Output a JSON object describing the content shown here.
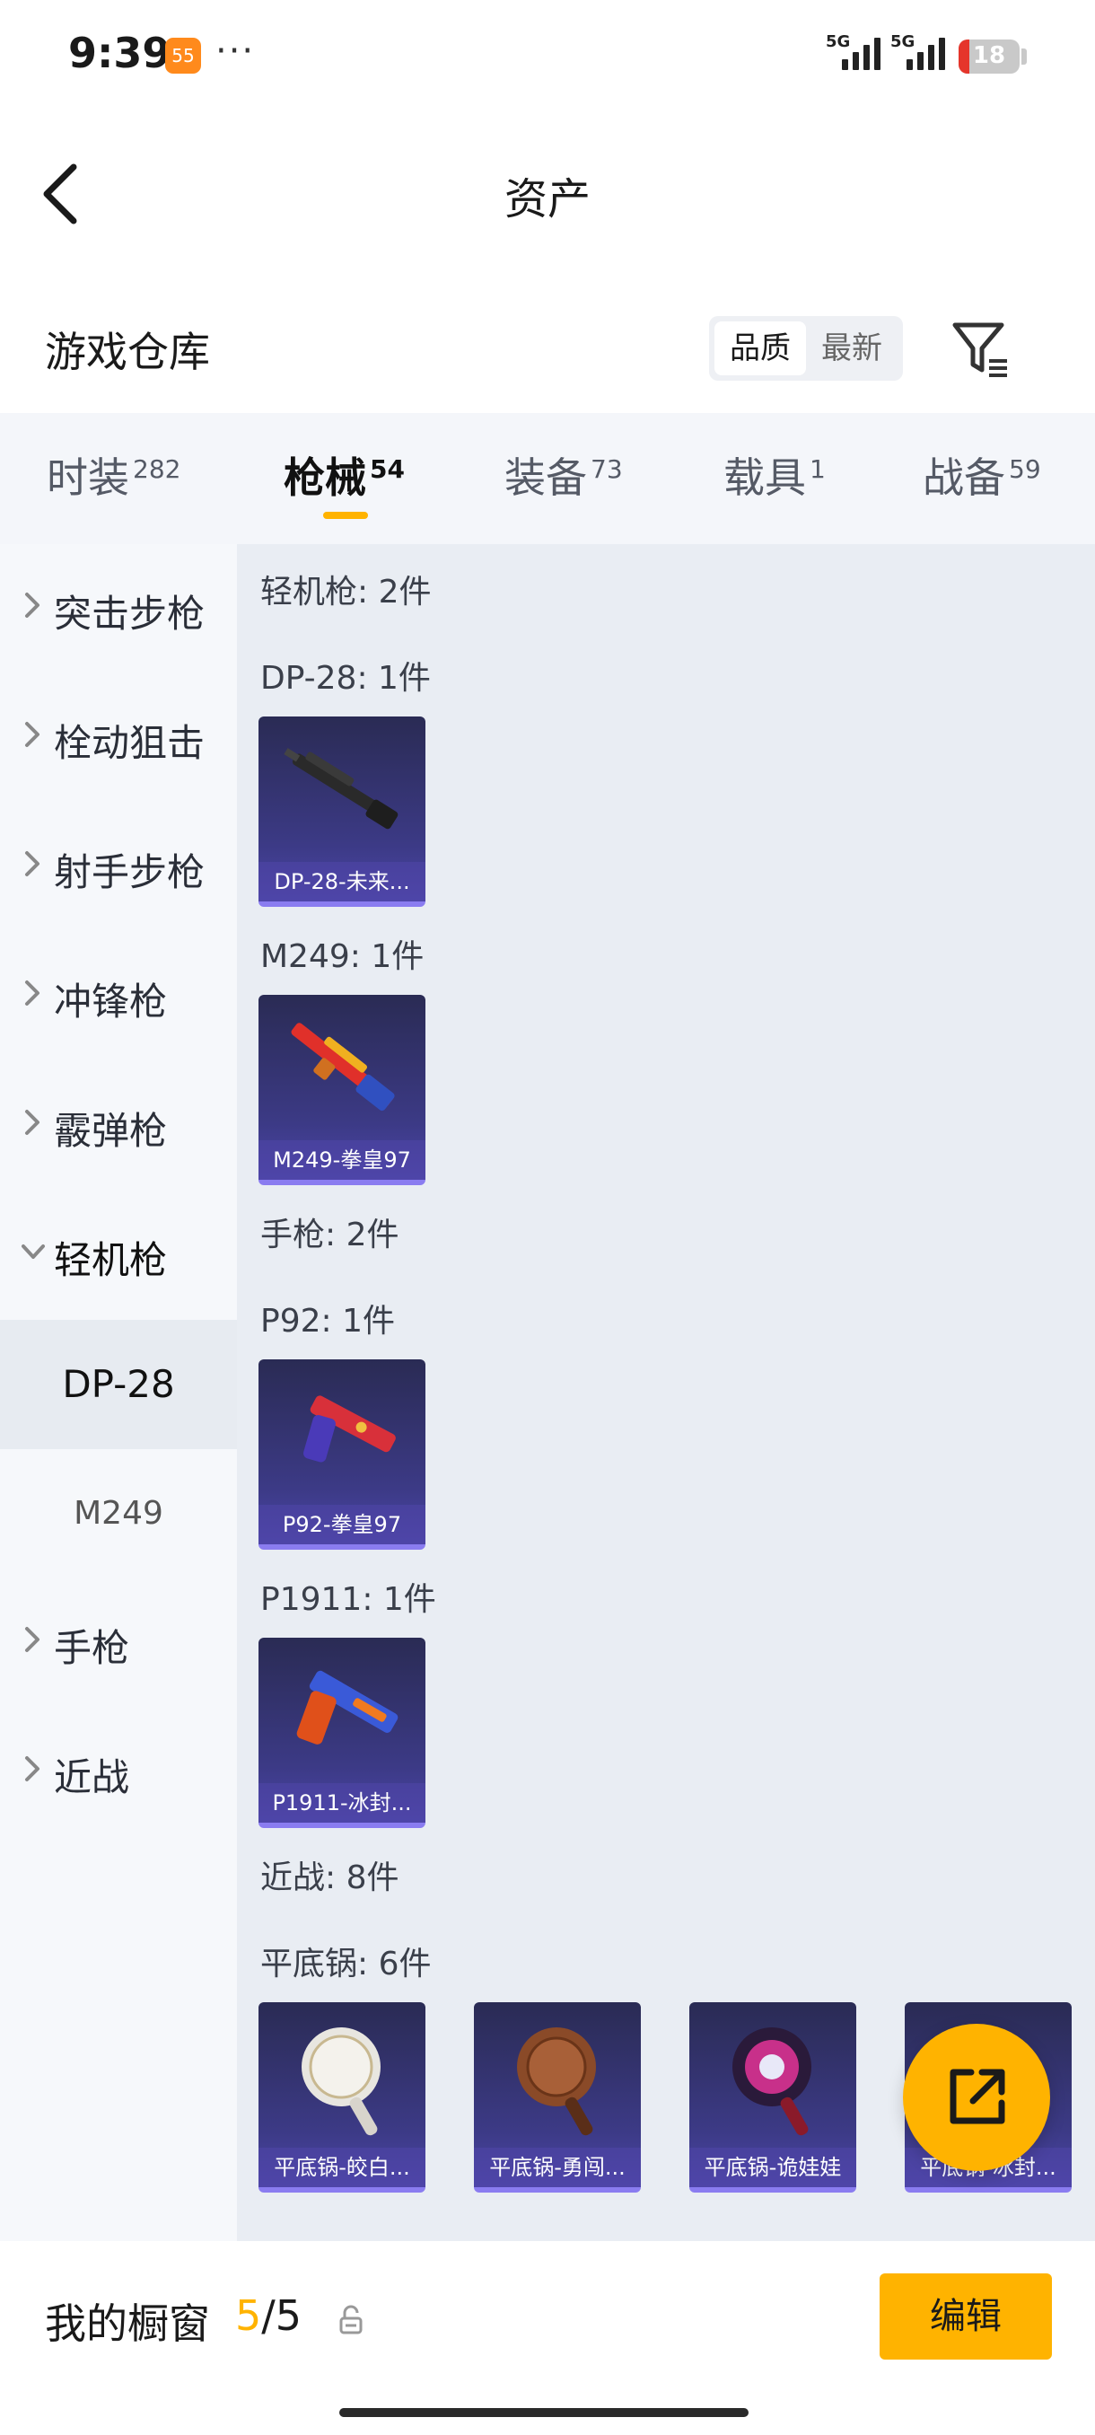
{
  "status_bar": {
    "time": "9:39",
    "app_badge": "55",
    "dots": "···",
    "signal_1": "5G",
    "signal_2": "5G",
    "battery": "18"
  },
  "nav": {
    "title": "资产"
  },
  "warehouse": {
    "title": "游戏仓库",
    "sort_quality": "品质",
    "sort_newest": "最新"
  },
  "tabs": [
    {
      "label": "时装",
      "count": "282"
    },
    {
      "label": "枪械",
      "count": "54"
    },
    {
      "label": "装备",
      "count": "73"
    },
    {
      "label": "载具",
      "count": "1"
    },
    {
      "label": "战备",
      "count": "59"
    }
  ],
  "sidebar": {
    "items": [
      {
        "label": "突击步枪"
      },
      {
        "label": "栓动狙击"
      },
      {
        "label": "射手步枪"
      },
      {
        "label": "冲锋枪"
      },
      {
        "label": "霰弹枪"
      },
      {
        "label": "轻机枪"
      }
    ],
    "sub_items": [
      {
        "label": "DP-28"
      },
      {
        "label": "M249"
      }
    ],
    "items_after": [
      {
        "label": "手枪"
      },
      {
        "label": "近战"
      }
    ]
  },
  "content": {
    "lmg_header": "轻机枪: 2件",
    "dp28_header": "DP-28: 1件",
    "dp28_card": "DP-28-未来...",
    "m249_header": "M249: 1件",
    "m249_card": "M249-拳皇97",
    "pistol_header": "手枪: 2件",
    "p92_header": "P92: 1件",
    "p92_card": "P92-拳皇97",
    "p1911_header": "P1911: 1件",
    "p1911_card": "P1911-冰封...",
    "melee_header": "近战: 8件",
    "pan_header": "平底锅: 6件",
    "pan_cards": [
      "平底锅-皎白...",
      "平底锅-勇闯...",
      "平底锅-诡娃娃",
      "平底锅-冰封..."
    ]
  },
  "bottom": {
    "title": "我的橱窗",
    "count_current": "5",
    "count_sep": "/",
    "count_total": "5",
    "edit": "编辑"
  },
  "colors": {
    "accent": "#ffb300",
    "card_bg": "#3c3a86",
    "content_bg": "#e9edf3",
    "sidebar_bg": "#f6f8fb"
  }
}
